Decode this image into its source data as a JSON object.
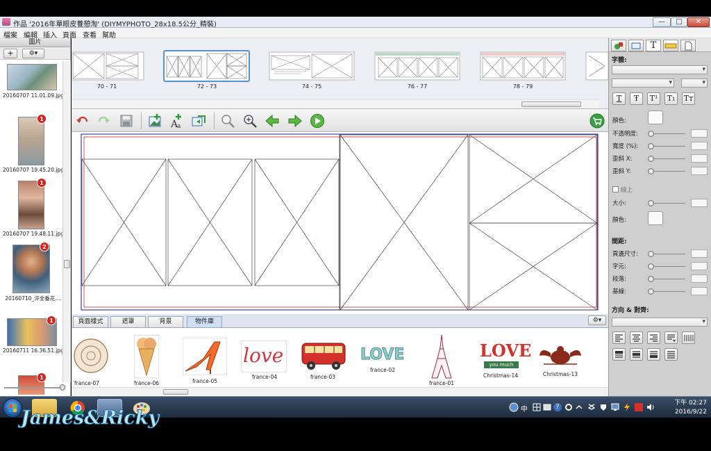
{
  "window": {
    "title": "作品 '2016年單眼皮養憩淘' (DIYMYPHOTO_28x18.5公分_精裝)",
    "buttons": {
      "minimize": "—",
      "maximize": "□",
      "close": "✕"
    }
  },
  "menubar": {
    "items": [
      "檔案",
      "編輯",
      "插入",
      "頁面",
      "查看",
      "幫助"
    ]
  },
  "left_panel": {
    "header": "圖片",
    "add_label": "+",
    "settings_label": "⚙▾",
    "photos": [
      {
        "caption": "20160707 11.01.09.jpg",
        "badge": ""
      },
      {
        "caption": "20160707 19.45.20.jpg",
        "badge": "1"
      },
      {
        "caption": "20160707 19.48.11.jpg",
        "badge": "1"
      },
      {
        "caption": "20160710_淬全番花....",
        "badge": "2"
      },
      {
        "caption": "20160711 16.36.51.jpg",
        "badge": "1"
      },
      {
        "caption": "",
        "badge": "1"
      }
    ]
  },
  "page_strip": {
    "pages": [
      {
        "label": "70 - 71",
        "selected": false
      },
      {
        "label": "72 - 73",
        "selected": true
      },
      {
        "label": "74 - 75",
        "selected": false
      },
      {
        "label": "76 - 77",
        "selected": false
      },
      {
        "label": "78 - 79",
        "selected": false
      }
    ]
  },
  "toolbar": {
    "icons": [
      "undo-icon",
      "redo-icon",
      "save-icon",
      "add-photo-icon",
      "add-text-icon",
      "replace-image-icon",
      "zoom-out-icon",
      "zoom-in-icon",
      "previous-page-icon",
      "next-page-icon",
      "play-icon",
      "cart-icon"
    ]
  },
  "bottom_tabs": {
    "tabs": [
      {
        "label": "頁面樣式",
        "active": false
      },
      {
        "label": "遮罩",
        "active": false
      },
      {
        "label": "背景",
        "active": false
      },
      {
        "label": "物件庫",
        "active": true
      }
    ],
    "settings_label": "⚙▾"
  },
  "stickers": [
    {
      "caption": "france-07"
    },
    {
      "caption": "france-06"
    },
    {
      "caption": "france-05"
    },
    {
      "caption": "france-04",
      "art": "love"
    },
    {
      "caption": "france-03"
    },
    {
      "caption": "france-02",
      "art": "LOVE"
    },
    {
      "caption": "france-01"
    },
    {
      "caption": "Christmas-14",
      "art": "LOVE",
      "art_sub": "you much"
    },
    {
      "caption": "Christmas-13"
    }
  ],
  "right_panel": {
    "font_label": "字體:",
    "format_buttons": [
      "T",
      "Ŧ",
      "T¹",
      "T₁",
      "Tт"
    ],
    "color_label": "顏色:",
    "sliders": [
      {
        "label": "不透明度:"
      },
      {
        "label": "寬度 (%):"
      },
      {
        "label": "歪斜 X:"
      },
      {
        "label": "歪斜 Y:"
      }
    ],
    "outline_label": "線上",
    "size_label": "大小:",
    "outline_color_label": "顏色:",
    "spacing_header": "間距:",
    "spacing_sliders": [
      {
        "label": "頁邊尺寸:"
      },
      {
        "label": "字元:"
      },
      {
        "label": "段落:"
      },
      {
        "label": "基線:"
      }
    ],
    "align_header": "方向 & 對齊:"
  },
  "taskbar": {
    "tray": [
      "中",
      "?"
    ],
    "clock_time": "下午 02:27",
    "clock_date": "2016/9/22"
  },
  "watermark": "James&Ricky",
  "colors": {
    "selected_page_border": "#5a8fd8",
    "page_border_outer": "#1a1a8c",
    "page_border_inner": "#c0272d",
    "badge": "#d8231f",
    "watermark": "#b9e5f7"
  }
}
